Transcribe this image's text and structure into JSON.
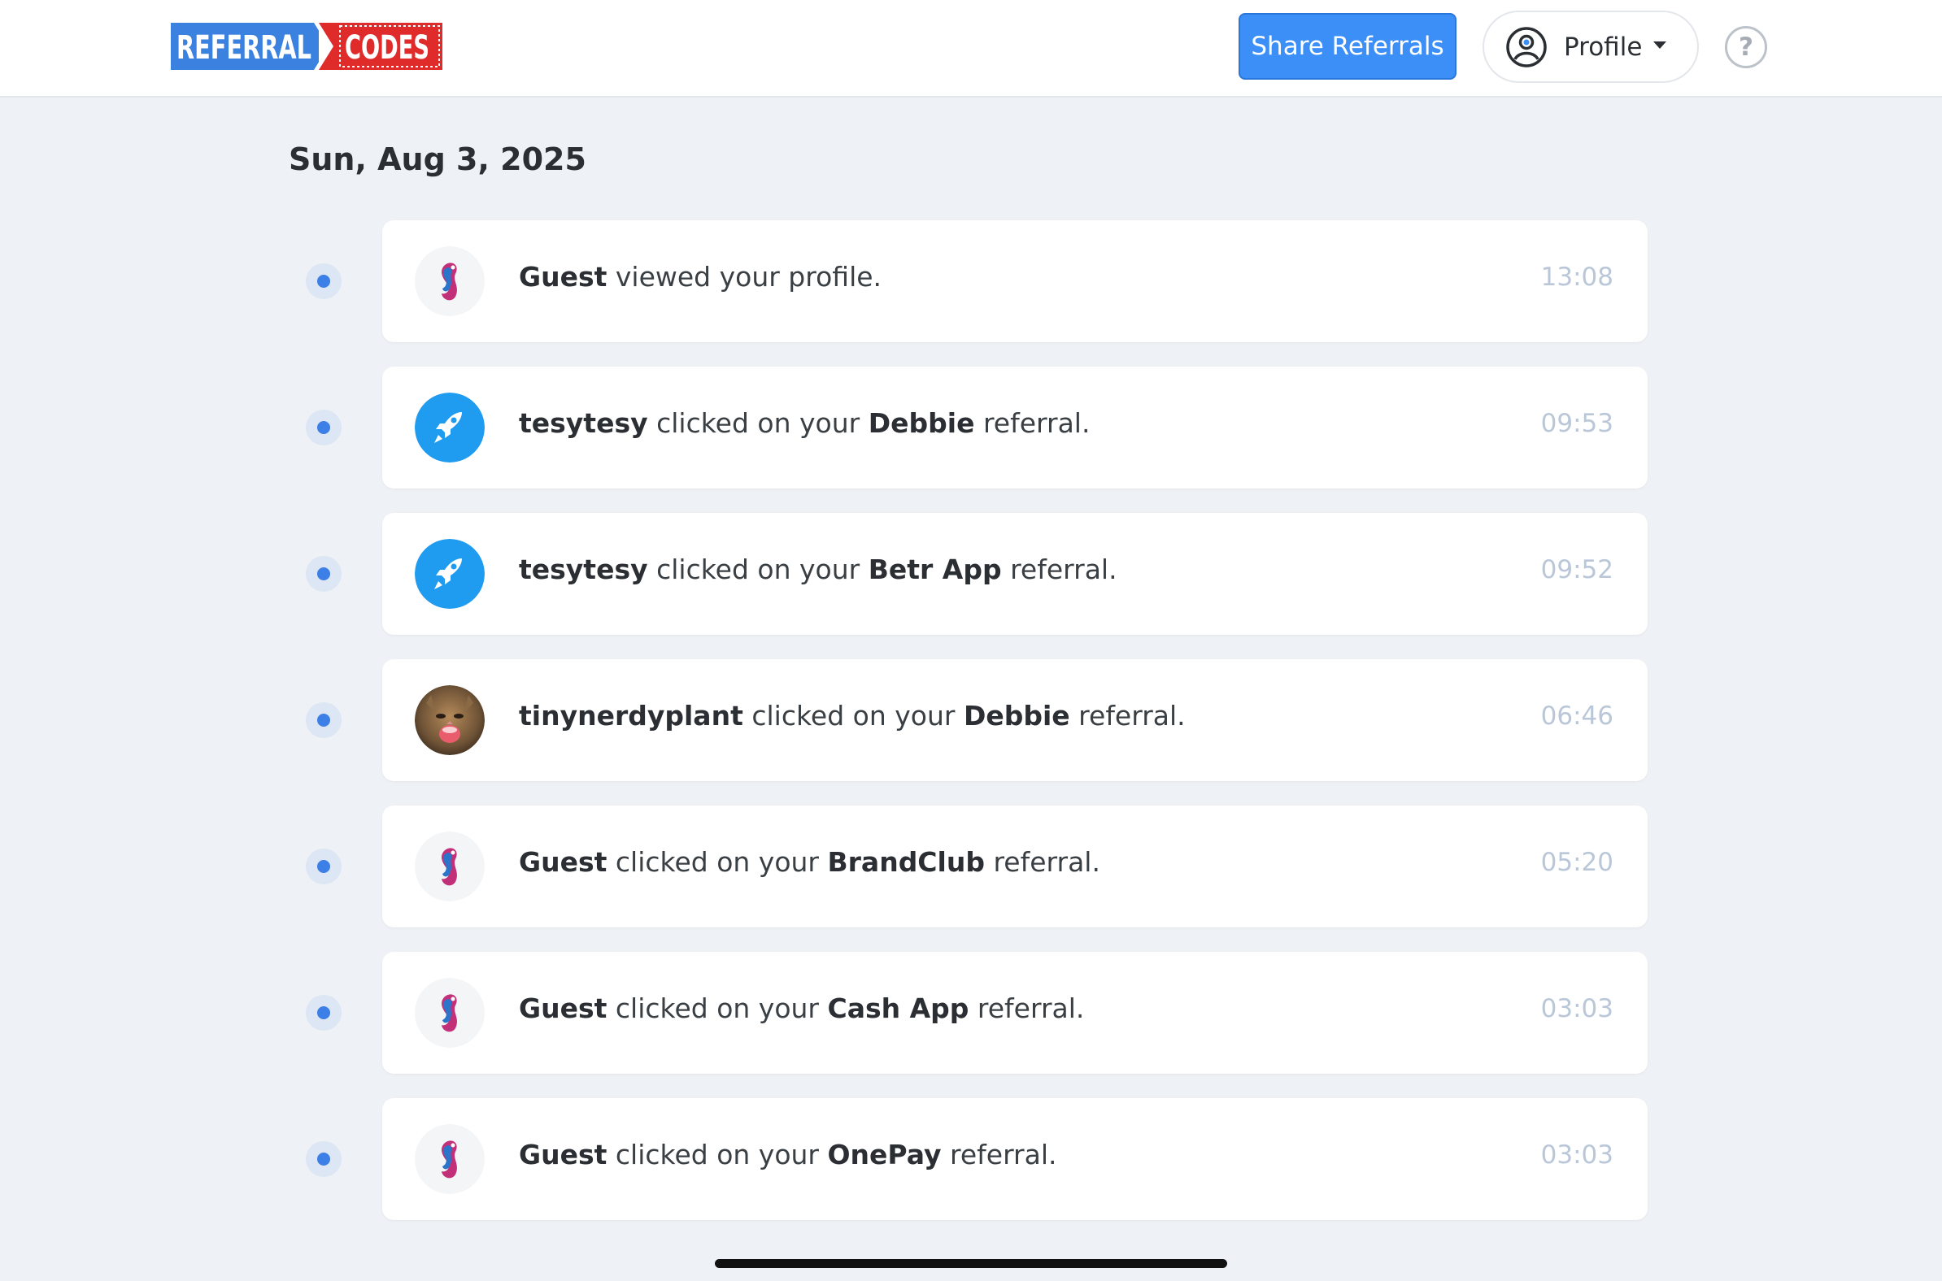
{
  "header": {
    "logo_left": "REFERRAL",
    "logo_right": "CODES",
    "share_label": "Share Referrals",
    "profile_label": "Profile",
    "help_label": "?"
  },
  "date": "Sun, Aug 3, 2025",
  "activities": [
    {
      "avatar": "guest-logo",
      "actor": "Guest",
      "action": "viewed your profile.",
      "brand": "",
      "suffix": "",
      "time": "13:08"
    },
    {
      "avatar": "rocket",
      "actor": "tesytesy",
      "action": "clicked on your",
      "brand": "Debbie",
      "suffix": "referral.",
      "time": "09:53"
    },
    {
      "avatar": "rocket",
      "actor": "tesytesy",
      "action": "clicked on your",
      "brand": "Betr App",
      "suffix": "referral.",
      "time": "09:52"
    },
    {
      "avatar": "cat-photo",
      "actor": "tinynerdyplant",
      "action": "clicked on your",
      "brand": "Debbie",
      "suffix": "referral.",
      "time": "06:46"
    },
    {
      "avatar": "guest-logo",
      "actor": "Guest",
      "action": "clicked on your",
      "brand": "BrandClub",
      "suffix": "referral.",
      "time": "05:20"
    },
    {
      "avatar": "guest-logo",
      "actor": "Guest",
      "action": "clicked on your",
      "brand": "Cash App",
      "suffix": "referral.",
      "time": "03:03"
    },
    {
      "avatar": "guest-logo",
      "actor": "Guest",
      "action": "clicked on your",
      "brand": "OnePay",
      "suffix": "referral.",
      "time": "03:03"
    }
  ],
  "colors": {
    "accent": "#3c8ff7",
    "logo_blue": "#3b82e0",
    "logo_red": "#e02b2b",
    "background": "#eef1f5",
    "timestamp": "#b9c7d8"
  }
}
